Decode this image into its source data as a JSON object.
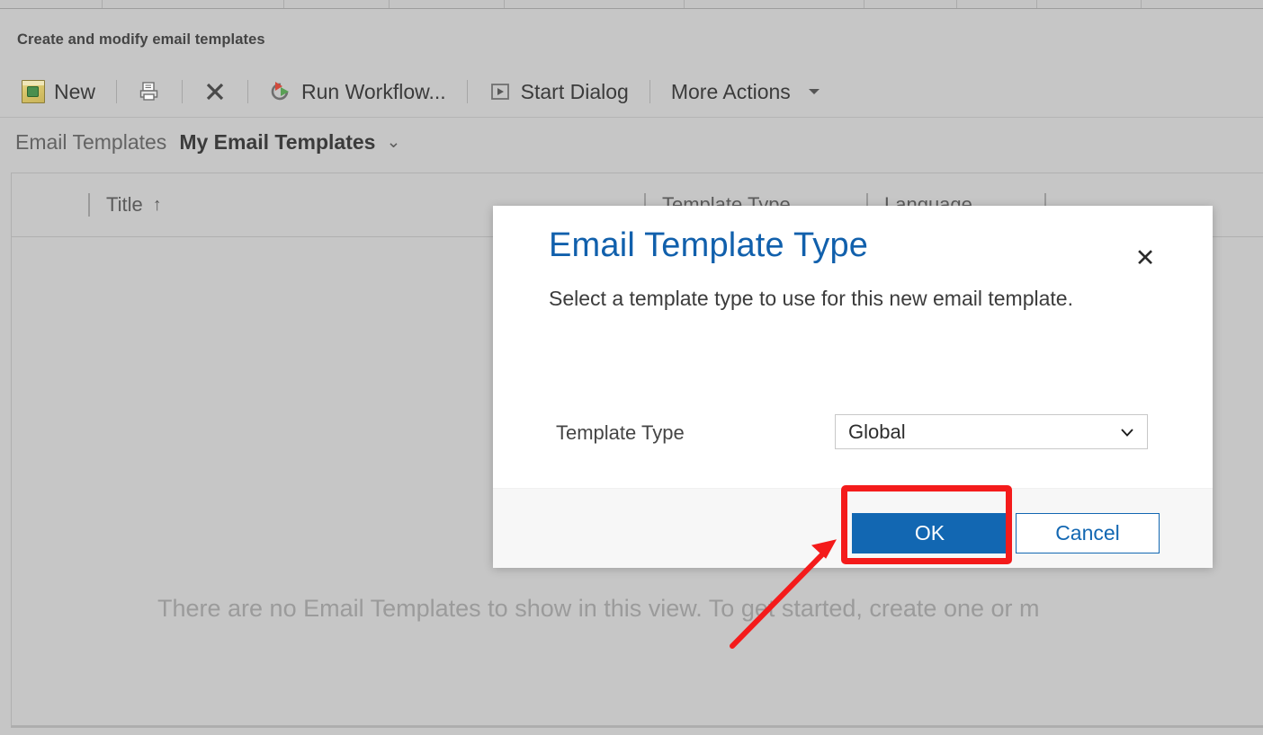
{
  "page": {
    "title": "Create and modify email templates"
  },
  "toolbar": {
    "items": [
      {
        "label": "New",
        "icon": "new-document-icon"
      },
      {
        "label": "",
        "icon": "print-icon"
      },
      {
        "label": "",
        "icon": "delete-x-icon"
      },
      {
        "label": "Run Workflow...",
        "icon": "run-workflow-icon"
      },
      {
        "label": "Start Dialog",
        "icon": "start-dialog-icon"
      },
      {
        "label": "More Actions",
        "icon": "caret-down-icon"
      }
    ],
    "new_label": "New",
    "run_workflow_label": "Run Workflow...",
    "start_dialog_label": "Start Dialog",
    "more_actions_label": "More Actions"
  },
  "view_selector": {
    "entity_label": "Email Templates",
    "current_view": "My Email Templates",
    "chevron": "⌄"
  },
  "grid": {
    "columns": [
      {
        "label": "Title",
        "sort": "↑"
      },
      {
        "label": "Template Type",
        "sort": ""
      },
      {
        "label": "Language",
        "sort": ""
      }
    ],
    "empty_message": "There are no Email Templates to show in this view. To get started, create one or m"
  },
  "dialog": {
    "title": "Email Template Type",
    "subtitle": "Select a template type to use for this new email template.",
    "close_label": "✕",
    "field_label": "Template Type",
    "selected_value": "Global",
    "options": [
      "Global"
    ],
    "ok_label": "OK",
    "cancel_label": "Cancel"
  },
  "annotation": {
    "highlight_color": "#f41b1b",
    "arrow_color": "#f41b1b",
    "target": "ok-button"
  },
  "colors": {
    "app_background": "#c6c6c6",
    "dialog_background": "#ffffff",
    "dialog_footer": "#f7f7f7",
    "accent_blue": "#1267b2",
    "title_blue": "#1160ac",
    "muted_text": "#9b9b9b"
  }
}
